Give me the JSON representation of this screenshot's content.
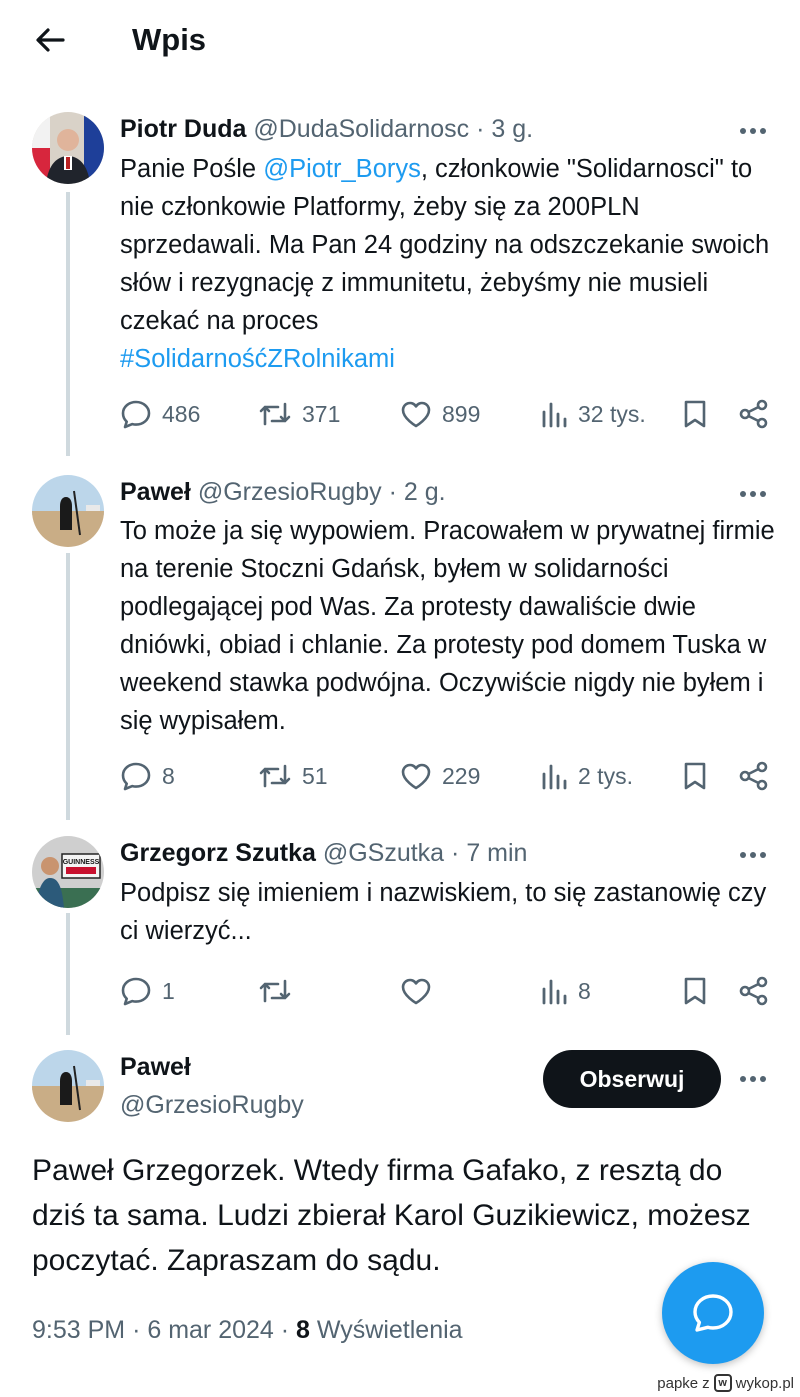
{
  "header": {
    "title": "Wpis"
  },
  "colors": {
    "accent": "#1d9bf0",
    "text": "#0f1419",
    "secondary": "#536471",
    "thread_line": "#cfd9de"
  },
  "tweets": [
    {
      "name": "Piotr Duda",
      "handle": "@DudaSolidarnosc",
      "sep": "·",
      "time": "3 g.",
      "text_before_mention": "Panie Pośle ",
      "mention": "@Piotr_Borys",
      "text_lines_after_mention": ", członkowie \"Solidarnosci\"",
      "text_rest": "to nie członkowie Platformy, żeby się za 200PLN sprzedawali. Ma Pan 24 godziny na odszczekanie swoich słów i rezygnację z immunitetu, żebyśmy nie musieli czekać na proces",
      "hashtag": "#SolidarnośćZRolnikami",
      "replies": "486",
      "reposts": "371",
      "likes": "899",
      "views": "32 tys."
    },
    {
      "name": "Paweł",
      "handle": "@GrzesioRugby",
      "sep": "·",
      "time": "2 g.",
      "text": "To może ja się wypowiem. Pracowałem w prywatnej firmie na terenie Stoczni Gdańsk, byłem w solidarności podlegającej pod Was. Za protesty dawaliście dwie dniówki, obiad i chlanie. Za protesty pod domem Tuska w weekend stawka podwójna. Oczywiście nigdy nie byłem i się wypisałem.",
      "replies": "8",
      "reposts": "51",
      "likes": "229",
      "views": "2 tys."
    },
    {
      "name": "Grzegorz Szutka",
      "handle": "@GSzutka",
      "sep": "·",
      "time": "7 min",
      "text": "Podpisz się imieniem i nazwiskiem, to się zastanowię czy ci wierzyć...",
      "replies": "1",
      "reposts": "",
      "likes": "",
      "views": "8",
      "avatar_sign_text": "GUINNESS"
    }
  ],
  "main_post": {
    "name": "Paweł",
    "handle": "@GrzesioRugby",
    "follow_label": "Obserwuj",
    "text": "Paweł Grzegorzek. Wtedy firma Gafako, z resztą do dziś ta sama. Ludzi zbierał Karol Guzikiewicz, możesz poczytać. Zapraszam do sądu.",
    "time": "9:53 PM",
    "date": "6 mar 2024",
    "sep": "·",
    "views_count": "8",
    "views_label": "Wyświetlenia"
  },
  "watermark": {
    "user": "papke",
    "z": "z",
    "site": "wykop.pl"
  },
  "icons": [
    "back-arrow-icon",
    "more-icon",
    "reply-icon",
    "repost-icon",
    "like-icon",
    "views-icon",
    "bookmark-icon",
    "share-icon",
    "compose-reply-icon"
  ]
}
